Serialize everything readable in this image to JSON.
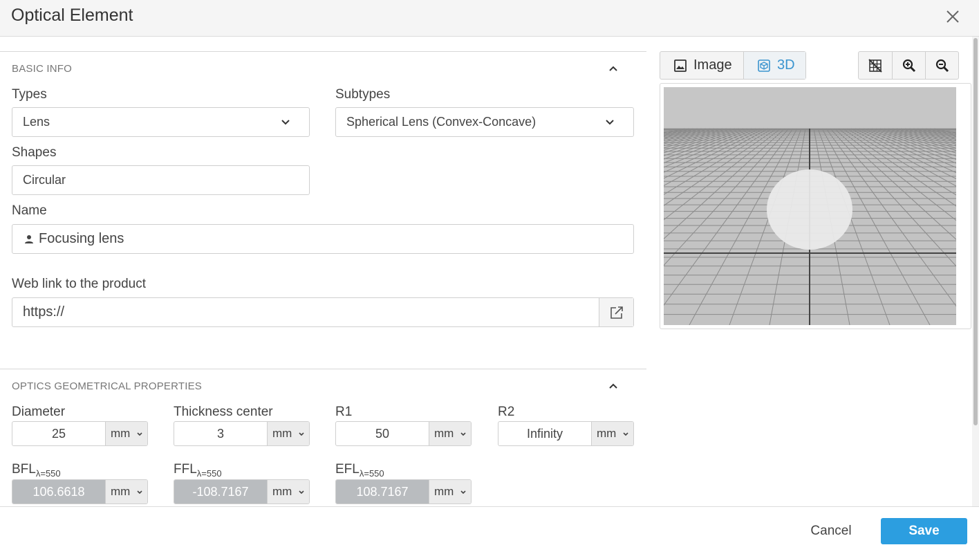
{
  "dialog": {
    "title": "Optical Element"
  },
  "basic_info": {
    "heading": "BASIC INFO",
    "types": {
      "label": "Types",
      "value": "Lens"
    },
    "subtypes": {
      "label": "Subtypes",
      "value": "Spherical Lens (Convex-Concave)"
    },
    "shapes": {
      "label": "Shapes",
      "value": "Circular"
    },
    "name": {
      "label": "Name",
      "value": "Focusing lens"
    },
    "weblink": {
      "label": "Web link to the product",
      "value": "https://"
    }
  },
  "optics": {
    "heading": "OPTICS GEOMETRICAL PROPERTIES",
    "diameter": {
      "label": "Diameter",
      "value": "25",
      "unit": "mm"
    },
    "thickness": {
      "label": "Thickness center",
      "value": "3",
      "unit": "mm"
    },
    "r1": {
      "label": "R1",
      "value": "50",
      "unit": "mm"
    },
    "r2": {
      "label": "R2",
      "value": "Infinity",
      "unit": "mm"
    },
    "bfl": {
      "label": "BFL",
      "sub": "λ=550",
      "value": "106.6618",
      "unit": "mm"
    },
    "ffl": {
      "label": "FFL",
      "sub": "λ=550",
      "value": "-108.7167",
      "unit": "mm"
    },
    "efl": {
      "label": "EFL",
      "sub": "λ=550",
      "value": "108.7167",
      "unit": "mm"
    }
  },
  "viewer": {
    "image_label": "Image",
    "three_d_label": "3D",
    "active_mode": "3D"
  },
  "footer": {
    "cancel_label": "Cancel",
    "save_label": "Save"
  },
  "colors": {
    "accent": "#2c9ee0",
    "readonly_field": "#b9bcbf"
  }
}
